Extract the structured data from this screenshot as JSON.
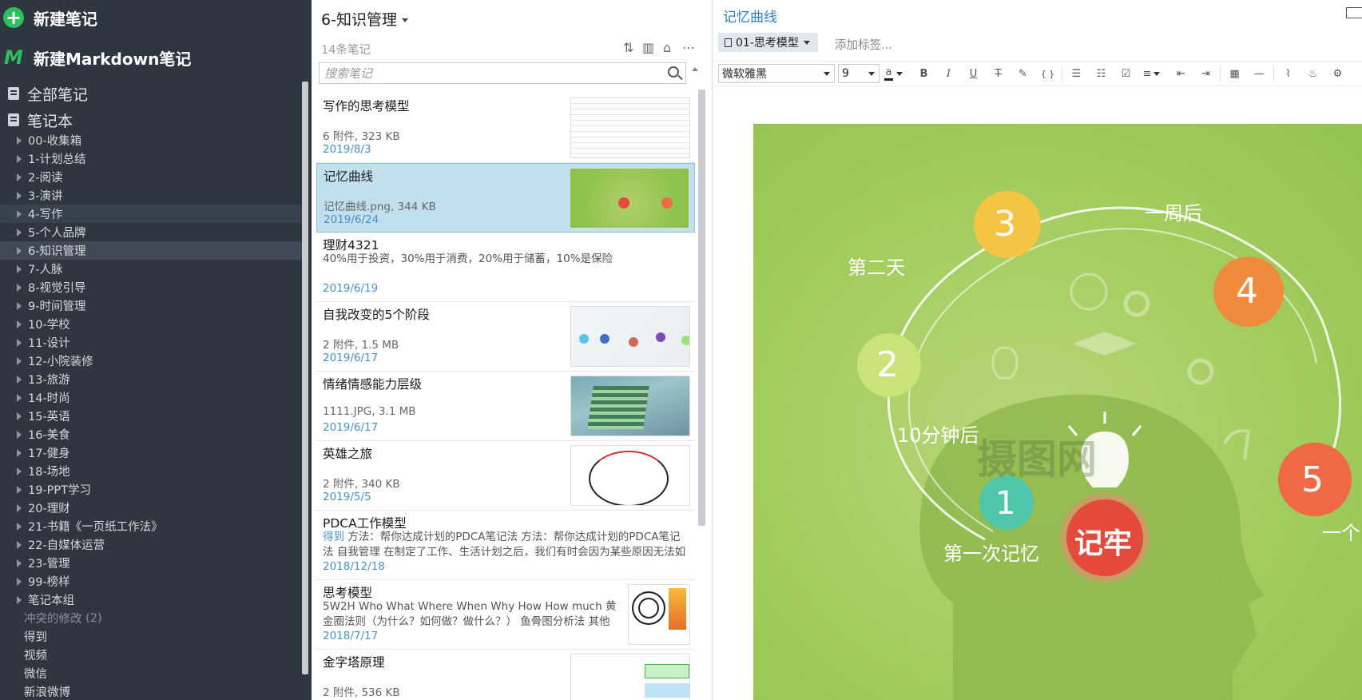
{
  "sidebar": {
    "new_note": "新建笔记",
    "new_markdown": "新建Markdown笔记",
    "all_notes": "全部笔记",
    "notebooks_root": "笔记本",
    "notebooks": [
      "00-收集箱",
      "1-计划总结",
      "2-阅读",
      "3-演讲",
      "4-写作",
      "5-个人品牌",
      "6-知识管理",
      "7-人脉",
      "8-视觉引导",
      "9-时间管理",
      "10-学校",
      "11-设计",
      "12-小院装修",
      "13-旅游",
      "14-时尚",
      "15-英语",
      "16-美食",
      "17-健身",
      "18-场地",
      "19-PPT学习",
      "20-理财",
      "21-书籍《一页纸工作法》",
      "22-自媒体运营",
      "23-管理",
      "99-榜样",
      "笔记本组"
    ],
    "conflict_label": "冲突的修改",
    "conflict_count": "(2)",
    "extras": [
      "得到",
      "视频",
      "微信",
      "新浪微博"
    ]
  },
  "notelist": {
    "title": "6-知识管理",
    "count": "14条笔记",
    "search_placeholder": "搜索笔记",
    "notes": [
      {
        "title": "写作的思考模型",
        "meta": "6 附件, 323 KB",
        "date": "2019/8/3"
      },
      {
        "title": "记忆曲线",
        "meta": "记忆曲线.png, 344 KB",
        "date": "2019/6/24"
      },
      {
        "title": "理财4321",
        "snippet": "40%用于投资，30%用于消费，20%用于储蓄，10%是保险",
        "date": "2019/6/19"
      },
      {
        "title": "自我改变的5个阶段",
        "meta": "2 附件, 1.5 MB",
        "date": "2019/6/17"
      },
      {
        "title": "情绪情感能力层级",
        "meta": "1111.JPG, 3.1 MB",
        "date": "2019/6/17"
      },
      {
        "title": "英雄之旅",
        "meta": "2 附件, 340 KB",
        "date": "2019/5/5"
      },
      {
        "title": "PDCA工作模型",
        "snippet_source": "得到",
        "snippet": " 方法：帮你达成计划的PDCA笔记法 方法：帮你达成计划的PDCA笔记法 自我管理 在制定了工作、生活计划之后，我们有时会因为某些原因无法如期完...",
        "date": "2018/12/18"
      },
      {
        "title": "思考模型",
        "snippet": "5W2H Who What Where When Why How How much 黄金圈法则（为什么？如何做？做什么？） 鱼骨图分析法 其他",
        "date": "2018/7/17"
      },
      {
        "title": "金字塔原理",
        "meta": "2 附件, 536 KB",
        "date": ""
      }
    ]
  },
  "editor": {
    "title": "记忆曲线",
    "notebook": "01-思考模型",
    "tag_placeholder": "添加标签...",
    "font": "微软雅黑",
    "size": "9",
    "toolbar": {
      "font_color": "a",
      "bold": "B",
      "italic": "I",
      "underline": "U",
      "strike": "T",
      "code": "{ }",
      "hr": "—"
    },
    "image": {
      "labels": {
        "n1": "1",
        "n2": "2",
        "n3": "3",
        "n4": "4",
        "n5": "5",
        "first": "第一次记忆",
        "ten_min": "10分钟后",
        "day2": "第二天",
        "week": "一周后",
        "month": "一个",
        "center": "记牢",
        "watermark": "摄图网"
      },
      "colors": {
        "bg": "#a3cc5e",
        "c1": "#4fc6a9",
        "c2": "#c9e27a",
        "c3": "#f4c542",
        "c4": "#f08a3c",
        "c5": "#ef6a44",
        "center": "#e54b3c"
      }
    }
  }
}
